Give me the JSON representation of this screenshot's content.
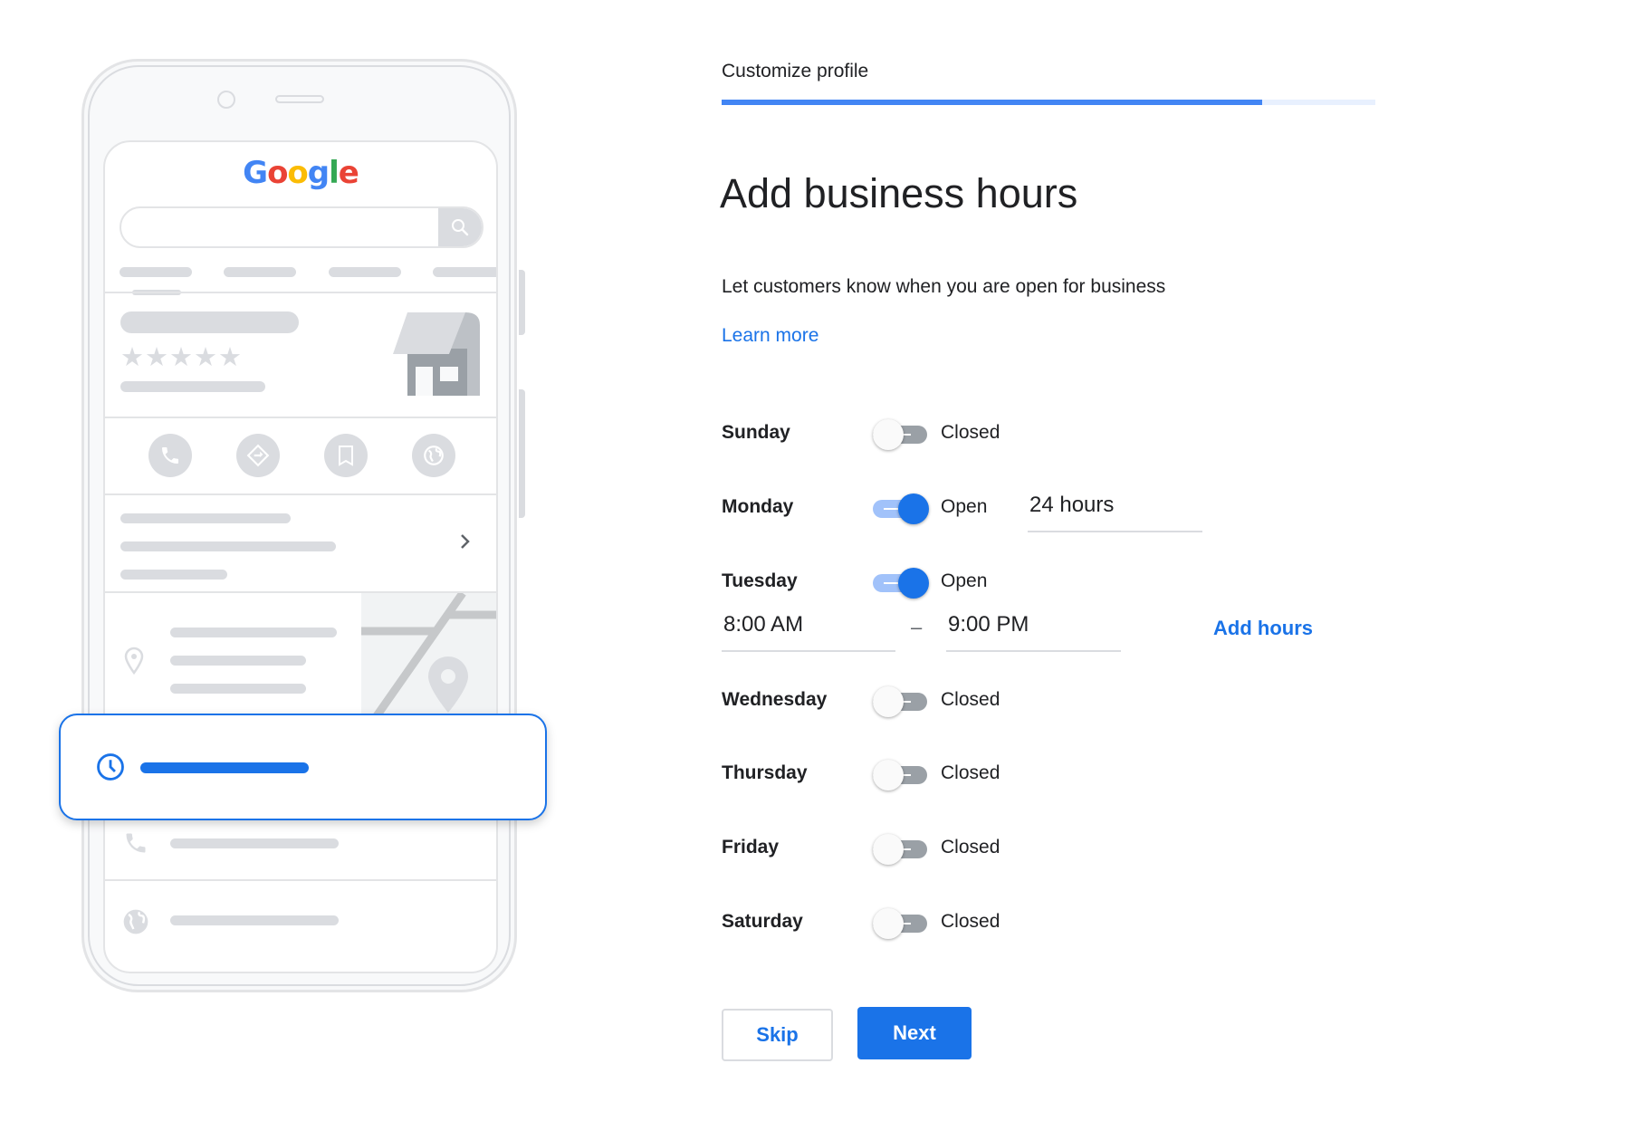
{
  "header": {
    "step_label": "Customize profile",
    "progress_fraction": 0.827
  },
  "page": {
    "title": "Add business hours",
    "subtitle": "Let customers know when you are open for business",
    "learn_more": "Learn more"
  },
  "days": [
    {
      "name": "Sunday",
      "open": false,
      "status": "Closed"
    },
    {
      "name": "Monday",
      "open": true,
      "status": "Open",
      "hours_value": "24 hours"
    },
    {
      "name": "Tuesday",
      "open": true,
      "status": "Open",
      "open_time": "8:00 AM",
      "separator": "–",
      "close_time": "9:00 PM",
      "add_hours": "Add hours"
    },
    {
      "name": "Wednesday",
      "open": false,
      "status": "Closed"
    },
    {
      "name": "Thursday",
      "open": false,
      "status": "Closed"
    },
    {
      "name": "Friday",
      "open": false,
      "status": "Closed"
    },
    {
      "name": "Saturday",
      "open": false,
      "status": "Closed"
    }
  ],
  "actions": {
    "skip": "Skip",
    "next": "Next"
  },
  "illustration": {
    "logo_letters": [
      {
        "ch": "G",
        "color": "#4285f4"
      },
      {
        "ch": "o",
        "color": "#ea4335"
      },
      {
        "ch": "o",
        "color": "#fbbc05"
      },
      {
        "ch": "g",
        "color": "#4285f4"
      },
      {
        "ch": "l",
        "color": "#34a853"
      },
      {
        "ch": "e",
        "color": "#ea4335"
      }
    ],
    "rating_stars": "★★★★★"
  },
  "colors": {
    "accent": "#1a73e8",
    "progress": "#4285f4",
    "progress_track": "#e8f0fe",
    "toggle_off": "#9aa0a6",
    "toggle_on_track": "#a1c2fa",
    "placeholder_gray": "#dadce0"
  }
}
